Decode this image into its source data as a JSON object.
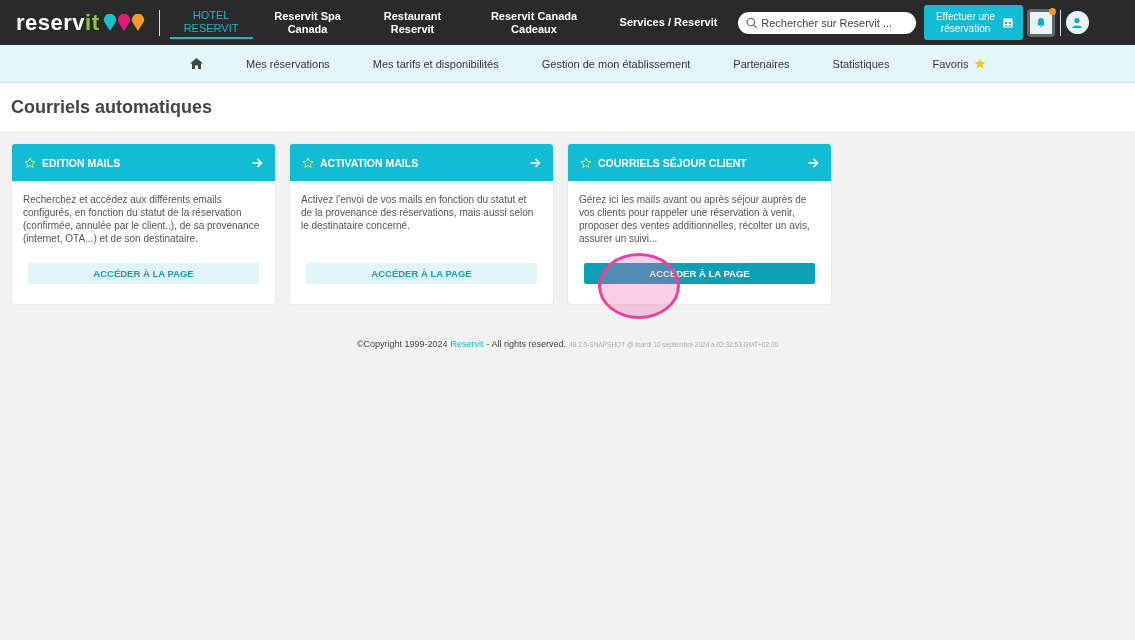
{
  "header": {
    "logo": "reservit",
    "products": [
      {
        "label": "HOTEL RESERVIT",
        "selected": true
      },
      {
        "label": "Reservit Spa Canada",
        "selected": false
      },
      {
        "label": "Restaurant Reservit",
        "selected": false
      },
      {
        "label": "Reservit Canada Cadeaux",
        "selected": false
      },
      {
        "label": "Services / Reservit",
        "selected": false
      }
    ],
    "search": {
      "placeholder": "Rechercher sur Reservit ..."
    },
    "book_button": "Effectuer une réservation",
    "notification": {
      "unread": true
    }
  },
  "nav": {
    "items": [
      {
        "label": "Mes réservations",
        "favorite": false
      },
      {
        "label": "Mes tarifs et disponibilités",
        "favorite": false
      },
      {
        "label": "Gestion de mon établissement",
        "favorite": false
      },
      {
        "label": "Partenaires",
        "favorite": false
      },
      {
        "label": "Statistiques",
        "favorite": false
      },
      {
        "label": "Favoris",
        "favorite": true
      }
    ]
  },
  "page_title": "Courriels automatiques",
  "cards": [
    {
      "title": "EDITION MAILS",
      "text": "Recherchez et accédez aux différents emails configurés, en fonction du statut de la réservation (confirmée, annulée par le client..), de sa provenance (internet, OTA...) et de son destinataire.",
      "button": "ACCÉDER À LA PAGE",
      "hovered": false
    },
    {
      "title": "ACTIVATION MAILS",
      "text": "Activez l'envoi de vos mails en fonction du statut et de la provenance des réservations, mais aussi selon le destinataire concerné.",
      "button": "ACCÉDER À LA PAGE",
      "hovered": false
    },
    {
      "title": "COURRIELS SÉJOUR CLIENT",
      "text": "Gérez ici les mails avant ou après séjour auprès de vos clients pour rappeler une réservation à venir, proposer des ventes additionnelles, récolter un avis, assurer un suivi...",
      "button": "ACCÉDER À LA PAGE",
      "hovered": true
    }
  ],
  "footer": {
    "copyright": "©Copyright 1999-2024",
    "link": "Reservit",
    "rights": "- All rights reserved.",
    "version": "48.2.0-SNAPSHOT @ mardi 10 septembre 2024 à 02:32:53 GMT+02:00"
  }
}
